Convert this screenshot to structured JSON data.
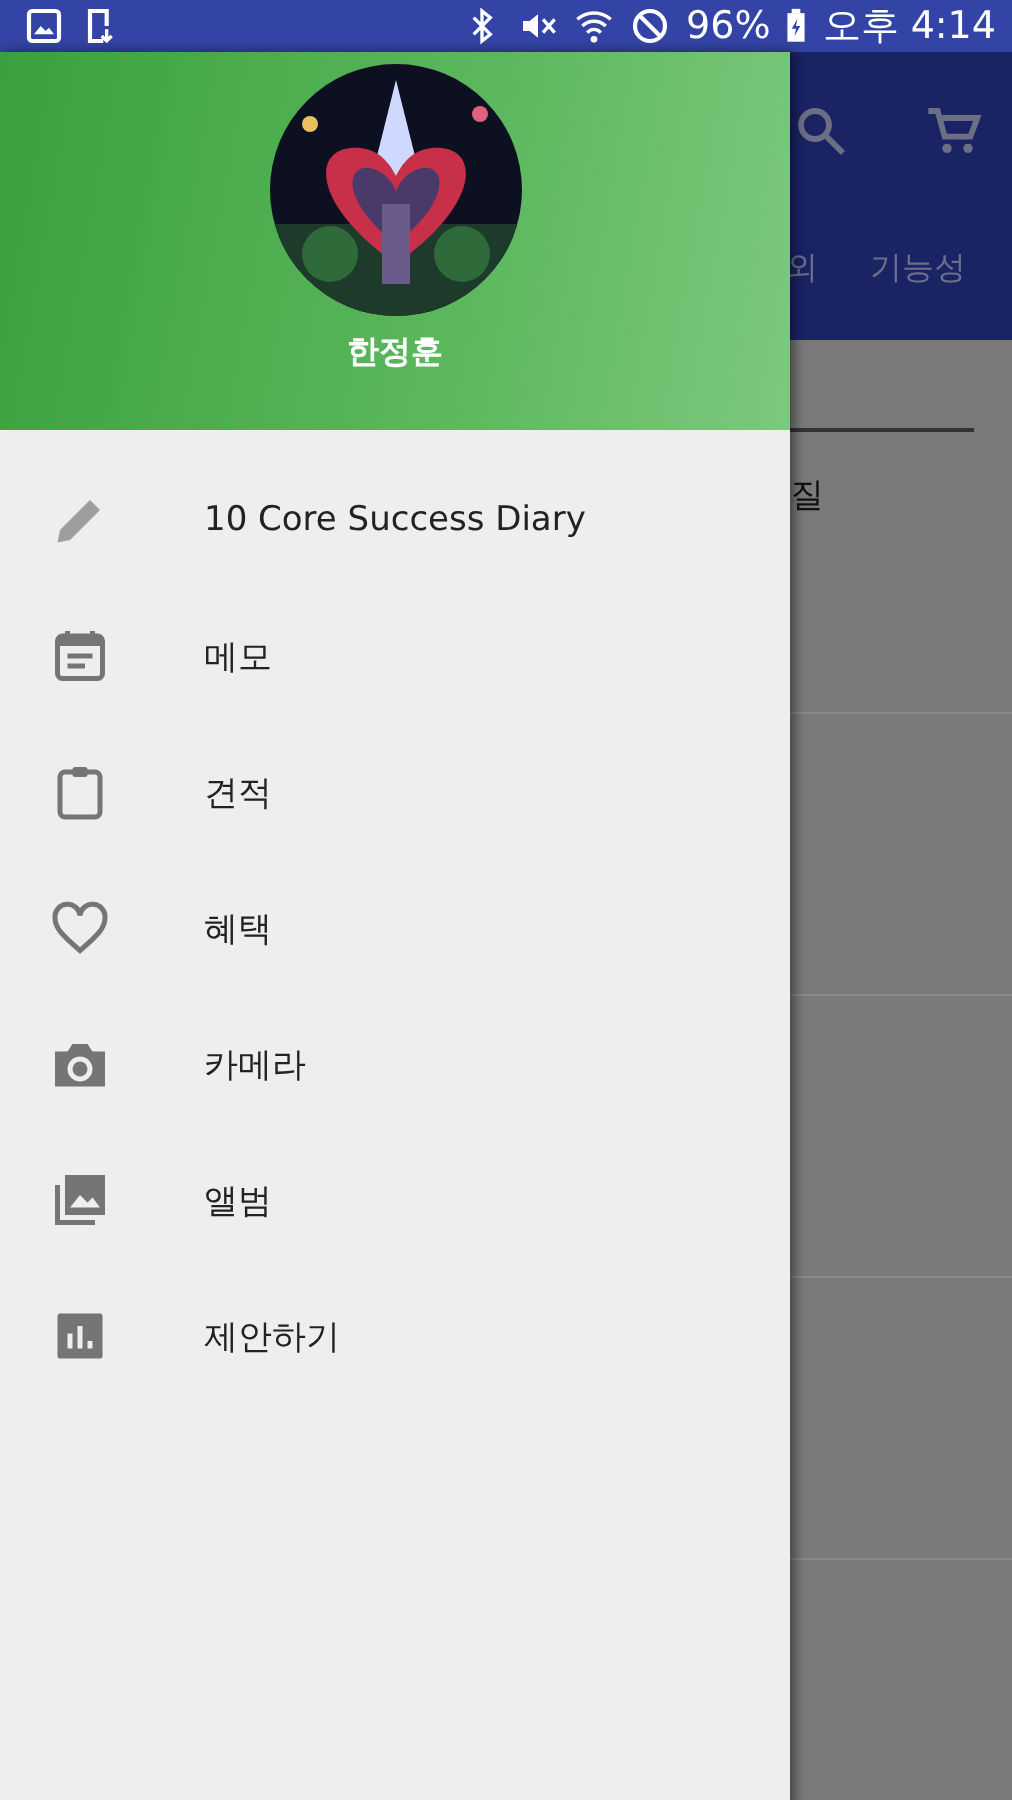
{
  "status_bar": {
    "battery": "96%",
    "time": "오후 4:14"
  },
  "drawer": {
    "user_name": "한정훈",
    "items": [
      {
        "kind": "pencil",
        "label": "10 Core Success Diary"
      },
      {
        "kind": "calendar",
        "label": "메모"
      },
      {
        "kind": "clipboard",
        "label": "견적"
      },
      {
        "kind": "heart",
        "label": "혜택"
      },
      {
        "kind": "camera",
        "label": "카메라"
      },
      {
        "kind": "album",
        "label": "앨범"
      },
      {
        "kind": "chart",
        "label": "제안하기"
      }
    ]
  },
  "background_app": {
    "tabs": [
      {
        "label": "외"
      },
      {
        "label": "기능성"
      }
    ],
    "content_text": "질"
  }
}
